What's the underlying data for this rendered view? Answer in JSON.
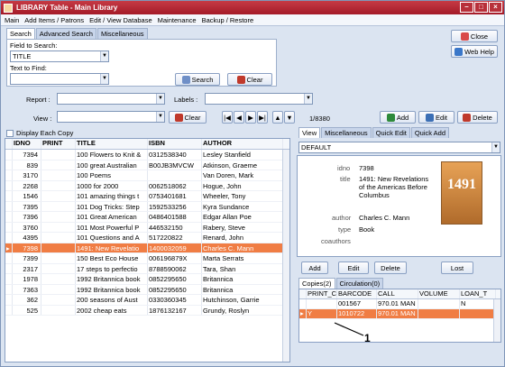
{
  "window": {
    "title": "LIBRARY Table - Main Library"
  },
  "menu": [
    "Main",
    "Add Items / Patrons",
    "Edit / View Database",
    "Maintenance",
    "Backup / Restore"
  ],
  "search_tabs": [
    "Search",
    "Advanced Search",
    "Miscellaneous"
  ],
  "search": {
    "field_label": "Field to Search:",
    "field_value": "TITLE",
    "find_label": "Text to Find:",
    "find_value": "",
    "search_btn": "Search",
    "clear_btn": "Clear"
  },
  "side": {
    "close": "Close",
    "webhelp": "Web Help"
  },
  "filters": {
    "report": "Report :",
    "labels": "Labels :",
    "view": "View :",
    "clear": "Clear",
    "counter": "1/8380",
    "add": "Add",
    "edit": "Edit",
    "delete": "Delete"
  },
  "display_each": "Display Each Copy",
  "table": {
    "headers": [
      "IDNO",
      "PRINT",
      "TITLE",
      "ISBN",
      "AUTHOR"
    ],
    "rows": [
      [
        "7394",
        "",
        "100 Flowers to Knit &",
        "0312538340",
        "Lesley Stanfield"
      ],
      [
        "839",
        "",
        "100 great Australian",
        "B00JB3MVCW",
        "Atkinson, Graeme"
      ],
      [
        "3170",
        "",
        "100 Poems",
        "",
        "Van Doren, Mark"
      ],
      [
        "2268",
        "",
        "1000 for 2000",
        "0062518062",
        "Hogue, John"
      ],
      [
        "1546",
        "",
        "101 amazing things t",
        "0753401681",
        "Wheeler, Tony"
      ],
      [
        "7395",
        "",
        "101 Dog Tricks: Step",
        "1592533256",
        "Kyra Sundance"
      ],
      [
        "7396",
        "",
        "101 Great American",
        "0486401588",
        "Edgar Allan Poe"
      ],
      [
        "3760",
        "",
        "101 Most Powerful P",
        "446532150",
        "Rabery, Steve"
      ],
      [
        "4395",
        "",
        "101 Questions and A",
        "517220822",
        "Renard, John"
      ],
      [
        "7398",
        "",
        "1491: New Revelatio",
        "1400032059",
        "Charles C. Mann"
      ],
      [
        "7399",
        "",
        "150 Best Eco House",
        "006196879X",
        "Marta Serrats"
      ],
      [
        "2317",
        "",
        "17 steps to perfectio",
        "8788590062",
        "Tara, Shan"
      ],
      [
        "1978",
        "",
        "1992 Britannica book",
        "0852295650",
        "Britannica"
      ],
      [
        "7363",
        "",
        "1992 Britannica book",
        "0852295650",
        "Britannica"
      ],
      [
        "362",
        "",
        "200 seasons of Aust",
        "0330360345",
        "Hutchinson, Garrie"
      ],
      [
        "525",
        "",
        "2002 cheap eats",
        "1876132167",
        "Grundy, Roslyn"
      ]
    ],
    "selected": 9
  },
  "right_tabs": [
    "View",
    "Miscellaneous",
    "Quick Edit",
    "Quick Add"
  ],
  "view_select": "DEFAULT",
  "detail": {
    "idno_k": "idno",
    "idno": "7398",
    "title_k": "title",
    "title": "1491: New Revelations of the Americas Before Columbus",
    "author_k": "author",
    "author": "Charles C. Mann",
    "type_k": "type",
    "type": "Book",
    "coauthors_k": "coauthors",
    "cover": "1491"
  },
  "copy_btns": {
    "add": "Add",
    "edit": "Edit",
    "delete": "Delete",
    "lost": "Lost"
  },
  "copy_tabs": [
    "Copies(2)",
    "Circulation(0)"
  ],
  "copies": {
    "headers": [
      "PRINT_C",
      "BARCODE",
      "CALL",
      "VOLUME",
      "LOAN_T"
    ],
    "rows": [
      [
        "",
        "001567",
        "970.01 MAN",
        "",
        "N"
      ],
      [
        "Y",
        "1010722",
        "970.01 MAN",
        "",
        ""
      ]
    ]
  },
  "callout": "1",
  "colors": {
    "selected": "#f07d44",
    "title_bar": "#b52532"
  }
}
